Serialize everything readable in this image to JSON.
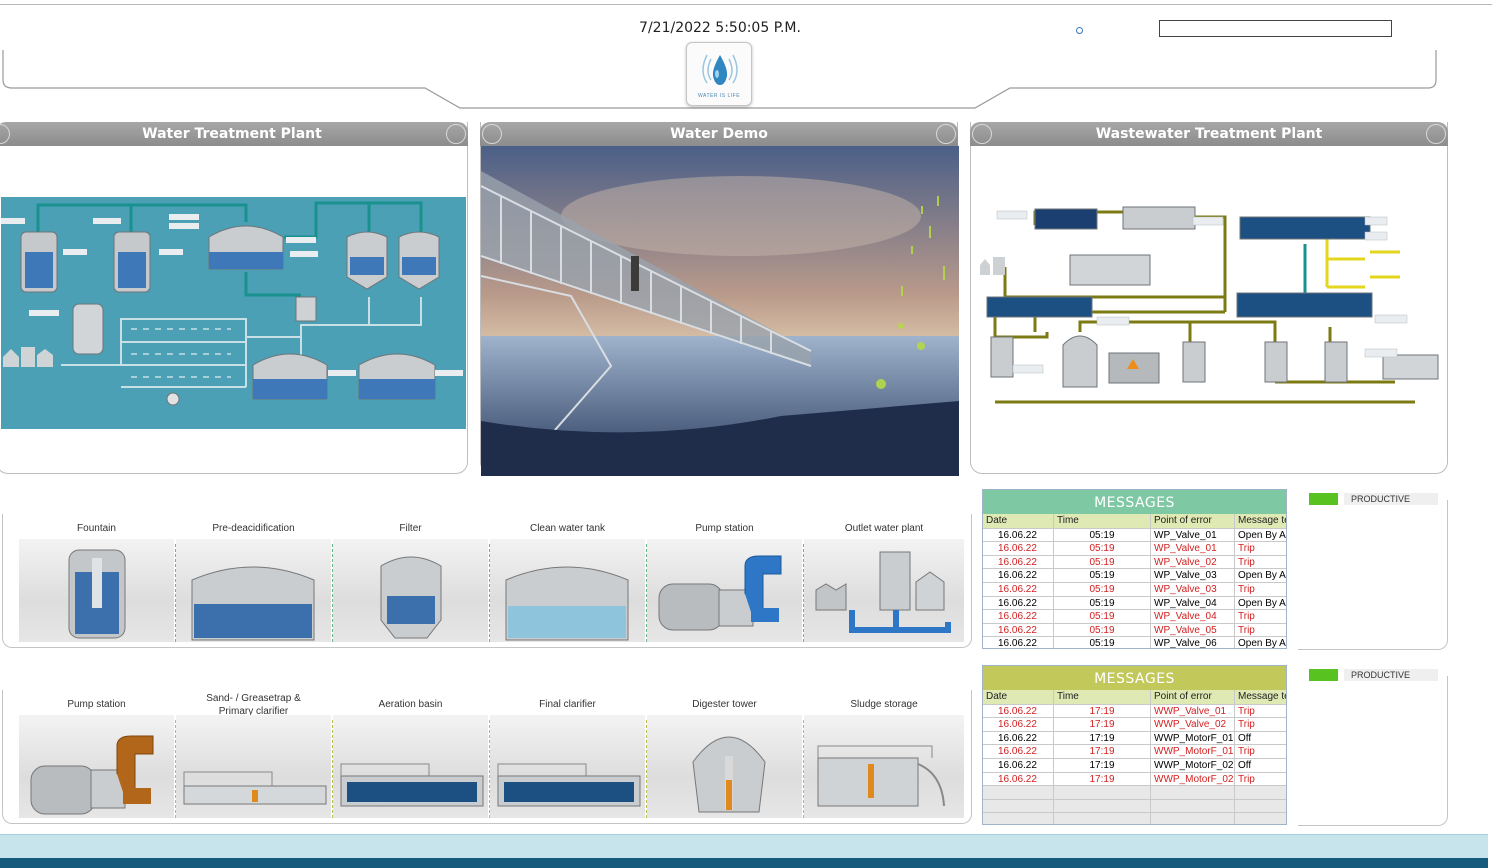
{
  "header": {
    "datetime": "7/21/2022 5:50:05 P.M.",
    "search_value": "",
    "logo_text": "WATER IS LIFE"
  },
  "panels": [
    {
      "title": "Water Treatment Plant"
    },
    {
      "title": "Water Demo"
    },
    {
      "title": "Wastewater Treatment Plant"
    }
  ],
  "water_row": [
    "Fountain",
    "Pre-deacidification",
    "Filter",
    "Clean water tank",
    "Pump station",
    "Outlet water plant"
  ],
  "wastewater_row": [
    "Pump station",
    "Sand- / Greasetrap & Primary clarifier",
    "Aeration basin",
    "Final clarifier",
    "Digester tower",
    "Sludge storage"
  ],
  "messages_wp": {
    "title": "MESSAGES",
    "columns": [
      "Date",
      "Time",
      "Point of error",
      "Message te"
    ],
    "rows": [
      {
        "date": "16.06.22",
        "time": "05:19",
        "point": "WP_Valve_01",
        "msg": "Open By Au",
        "trip": false
      },
      {
        "date": "16.06.22",
        "time": "05:19",
        "point": "WP_Valve_01",
        "msg": "Trip",
        "trip": true
      },
      {
        "date": "16.06.22",
        "time": "05:19",
        "point": "WP_Valve_02",
        "msg": "Trip",
        "trip": true
      },
      {
        "date": "16.06.22",
        "time": "05:19",
        "point": "WP_Valve_03",
        "msg": "Open By Au",
        "trip": false
      },
      {
        "date": "16.06.22",
        "time": "05:19",
        "point": "WP_Valve_03",
        "msg": "Trip",
        "trip": true
      },
      {
        "date": "16.06.22",
        "time": "05:19",
        "point": "WP_Valve_04",
        "msg": "Open By Au",
        "trip": false
      },
      {
        "date": "16.06.22",
        "time": "05:19",
        "point": "WP_Valve_04",
        "msg": "Trip",
        "trip": true
      },
      {
        "date": "16.06.22",
        "time": "05:19",
        "point": "WP_Valve_05",
        "msg": "Trip",
        "trip": true
      },
      {
        "date": "16.06.22",
        "time": "05:19",
        "point": "WP_Valve_06",
        "msg": "Open By Au",
        "trip": false
      }
    ]
  },
  "messages_wwp": {
    "title": "MESSAGES",
    "columns": [
      "Date",
      "Time",
      "Point of error",
      "Message te"
    ],
    "rows": [
      {
        "date": "16.06.22",
        "time": "17:19",
        "point": "WWP_Valve_01",
        "msg": "Trip",
        "trip": true
      },
      {
        "date": "16.06.22",
        "time": "17:19",
        "point": "WWP_Valve_02",
        "msg": "Trip",
        "trip": true
      },
      {
        "date": "16.06.22",
        "time": "17:19",
        "point": "WWP_MotorF_01",
        "msg": "Off",
        "trip": false
      },
      {
        "date": "16.06.22",
        "time": "17:19",
        "point": "WWP_MotorF_01",
        "msg": "Trip",
        "trip": true
      },
      {
        "date": "16.06.22",
        "time": "17:19",
        "point": "WWP_MotorF_02",
        "msg": "Off",
        "trip": false
      },
      {
        "date": "16.06.22",
        "time": "17:19",
        "point": "WWP_MotorF_02",
        "msg": "Trip",
        "trip": true
      }
    ],
    "empty_rows": 3
  },
  "status": [
    {
      "label": "PRODUCTIVE",
      "color": "#58c320"
    },
    {
      "label": "PRODUCTIVE",
      "color": "#58c320"
    }
  ],
  "colors": {
    "wp_header": "#7fc8a4",
    "wwp_header": "#c2c85a",
    "trip": "#d42020",
    "plant_bg": "#4ba0b5",
    "pipe_teal": "#18918f",
    "pipe_olive": "#7c7a12"
  }
}
